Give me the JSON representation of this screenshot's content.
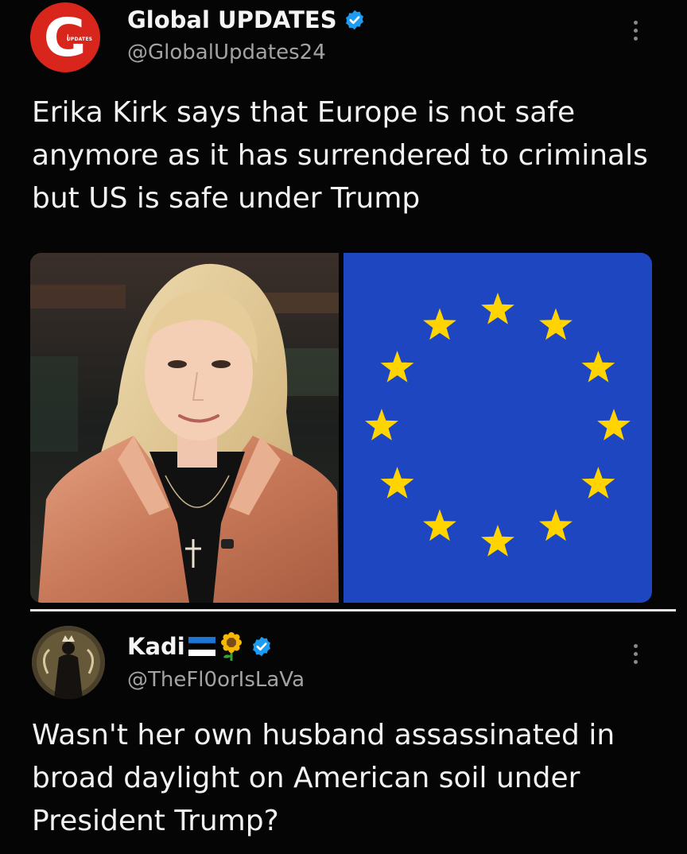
{
  "post1": {
    "display_name": "Global UPDATES",
    "handle": "@GlobalUpdates24",
    "avatar_letter": "G",
    "avatar_badge": "UPDATES",
    "text": "Erika Kirk says that Europe is not safe anymore as it has surrendered to criminals but US is safe under Trump",
    "verified": true,
    "media": [
      {
        "kind": "photo",
        "subject": "woman with long blonde hair in a pink satin blazer"
      },
      {
        "kind": "flag",
        "subject": "European Union flag"
      }
    ]
  },
  "post2": {
    "display_name": "Kadi",
    "handle": "@TheFl0orIsLaVa",
    "emojis": [
      "estonia-flag",
      "sunflower"
    ],
    "verified": true,
    "text": "Wasn't her own husband assassinated in broad daylight on American soil under President Trump?"
  },
  "colors": {
    "background": "#050505",
    "verified_badge": "#1d9bf0",
    "avatar_red": "#d9261c",
    "eu_blue": "#1e46c0",
    "eu_star": "#ffd400",
    "handle_gray": "#a3a3a3"
  }
}
